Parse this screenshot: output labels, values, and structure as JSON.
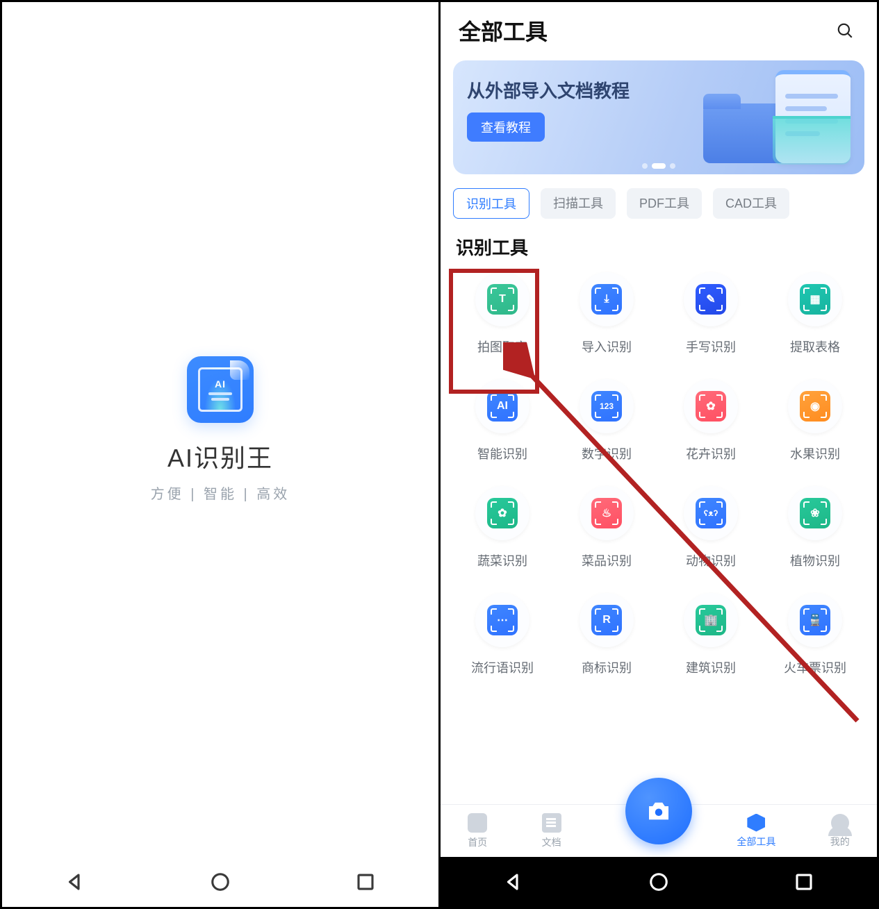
{
  "left": {
    "app_name": "AI识别王",
    "tagline": "方便 | 智能 | 高效",
    "icon_text": "AI"
  },
  "right": {
    "header": {
      "title": "全部工具"
    },
    "banner": {
      "title": "从外部导入文档教程",
      "button": "查看教程"
    },
    "tabs": [
      {
        "label": "识别工具",
        "active": true
      },
      {
        "label": "扫描工具",
        "active": false
      },
      {
        "label": "PDF工具",
        "active": false
      },
      {
        "label": "CAD工具",
        "active": false
      }
    ],
    "section_title": "识别工具",
    "tools": [
      {
        "label": "拍图取字",
        "glyph": "T",
        "bg": "linear-gradient(160deg,#3ac79a,#2fb88a)"
      },
      {
        "label": "导入识别",
        "glyph": "⤓",
        "bg": "linear-gradient(160deg,#3f86ff,#2f72ff)"
      },
      {
        "label": "手写识别",
        "glyph": "✎",
        "bg": "linear-gradient(160deg,#2f5dff,#2248e8)"
      },
      {
        "label": "提取表格",
        "glyph": "▦",
        "bg": "linear-gradient(160deg,#1fc7b1,#17b39f)"
      },
      {
        "label": "智能识别",
        "glyph": "AI",
        "bg": "linear-gradient(160deg,#3f86ff,#2f72ff)"
      },
      {
        "label": "数字识别",
        "glyph": "123",
        "bg": "linear-gradient(160deg,#3f86ff,#2f72ff)"
      },
      {
        "label": "花卉识别",
        "glyph": "✿",
        "bg": "linear-gradient(160deg,#ff6b7a,#ff4f62)"
      },
      {
        "label": "水果识别",
        "glyph": "◉",
        "bg": "linear-gradient(160deg,#ffa23c,#ff8c1f)"
      },
      {
        "label": "蔬菜识别",
        "glyph": "✿",
        "bg": "linear-gradient(160deg,#28c99b,#1db787)"
      },
      {
        "label": "菜品识别",
        "glyph": "♨",
        "bg": "linear-gradient(160deg,#ff6b7a,#ff4f62)"
      },
      {
        "label": "动物识别",
        "glyph": "ʕᴥʔ",
        "bg": "linear-gradient(160deg,#3f86ff,#2f72ff)"
      },
      {
        "label": "植物识别",
        "glyph": "❀",
        "bg": "linear-gradient(160deg,#28c99b,#1db787)"
      },
      {
        "label": "流行语识别",
        "glyph": "⋯",
        "bg": "linear-gradient(160deg,#3f86ff,#2f72ff)"
      },
      {
        "label": "商标识别",
        "glyph": "R",
        "bg": "linear-gradient(160deg,#3f86ff,#2f72ff)"
      },
      {
        "label": "建筑识别",
        "glyph": "🏢",
        "bg": "linear-gradient(160deg,#28c99b,#1db787)"
      },
      {
        "label": "火车票识别",
        "glyph": "🚆",
        "bg": "linear-gradient(160deg,#3f86ff,#2f72ff)"
      }
    ],
    "nav": [
      {
        "label": "首页",
        "active": false
      },
      {
        "label": "文档",
        "active": false
      },
      {
        "label": "全部工具",
        "active": true
      },
      {
        "label": "我的",
        "active": false
      }
    ]
  }
}
